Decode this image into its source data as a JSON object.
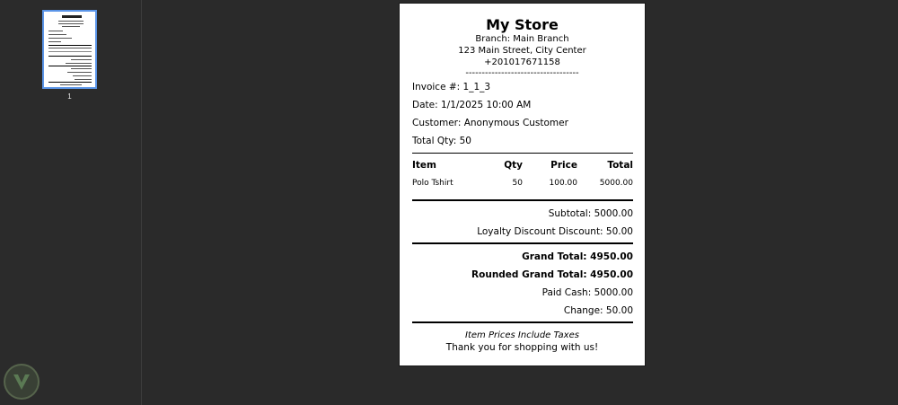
{
  "viewer": {
    "page_number_label": "1"
  },
  "receipt": {
    "store_name": "My Store",
    "branch": "Branch: Main Branch",
    "address": "123 Main Street, City Center",
    "phone": "+201017671158",
    "separator": "-----------------------------------",
    "invoice": "Invoice #: 1_1_3",
    "date": "Date: 1/1/2025 10:00 AM",
    "customer": "Customer: Anonymous Customer",
    "total_qty": "Total Qty: 50",
    "columns": [
      "Item",
      "Qty",
      "Price",
      "Total"
    ],
    "items": [
      {
        "item": "Polo Tshirt",
        "qty": "50",
        "price": "100.00",
        "total": "5000.00"
      }
    ],
    "subtotal": "Subtotal: 5000.00",
    "loyalty_discount": "Loyalty Discount Discount: 50.00",
    "grand_total": "Grand Total: 4950.00",
    "rounded_grand_total": "Rounded Grand Total: 4950.00",
    "paid_cash": "Paid Cash: 5000.00",
    "change": "Change: 50.00",
    "tax_note": "Item Prices Include Taxes",
    "thanks": "Thank you for shopping with us!"
  }
}
